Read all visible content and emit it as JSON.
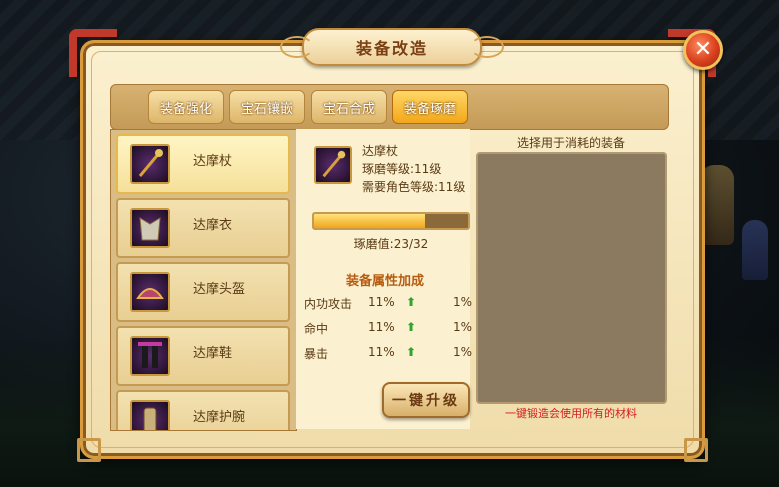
{
  "title": "装备改造",
  "tabs": [
    {
      "label": "装备强化",
      "active": false
    },
    {
      "label": "宝石镶嵌",
      "active": false
    },
    {
      "label": "宝石合成",
      "active": false
    },
    {
      "label": "装备琢磨",
      "active": true
    }
  ],
  "equipment_list": [
    {
      "name": "达摩杖",
      "selected": true,
      "icon": "staff-icon"
    },
    {
      "name": "达摩衣",
      "selected": false,
      "icon": "armor-icon"
    },
    {
      "name": "达摩头盔",
      "selected": false,
      "icon": "helmet-icon"
    },
    {
      "name": "达摩鞋",
      "selected": false,
      "icon": "boots-icon"
    },
    {
      "name": "达摩护腕",
      "selected": false,
      "icon": "bracer-icon"
    }
  ],
  "selected_item": {
    "name": "达摩杖",
    "polish_level": "琢磨等级:11级",
    "required_level": "需要角色等级:11级",
    "progress_text": "琢磨值:23/32",
    "progress_fraction": 0.72
  },
  "attributes": {
    "title": "装备属性加成",
    "rows": [
      {
        "name": "内功攻击",
        "value": "11%",
        "bonus": "1%"
      },
      {
        "name": "命中",
        "value": "11%",
        "bonus": "1%"
      },
      {
        "name": "暴击",
        "value": "11%",
        "bonus": "1%"
      }
    ],
    "up_glyph": "⬆"
  },
  "upgrade_button": "一键升级",
  "right_panel": {
    "title": "选择用于消耗的装备",
    "hint": "一键锻造会使用所有的材料"
  },
  "close_glyph": "✕",
  "colors": {
    "accent": "#f2a61a",
    "hint_red": "#d21e1e",
    "up_green": "#2fa52f"
  }
}
